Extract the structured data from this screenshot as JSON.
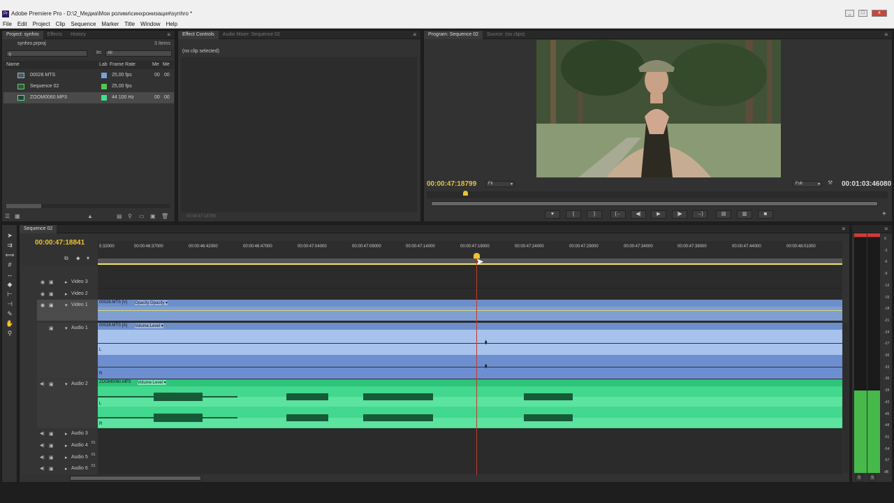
{
  "window": {
    "app_icon": "Pr",
    "title": "Adobe Premiere Pro - D:\\2_Медиа\\Мои ролики\\синхронизация\\synhro *"
  },
  "menu": [
    "File",
    "Edit",
    "Project",
    "Clip",
    "Sequence",
    "Marker",
    "Title",
    "Window",
    "Help"
  ],
  "project_panel": {
    "tabs": [
      "Project: synhro",
      "Effects",
      "History"
    ],
    "project_file": "synhro.prproj",
    "item_count": "3 Items",
    "in_label": "In:",
    "in_value": "All",
    "columns": [
      "Name",
      "Lab",
      "Frame Rate",
      "Me",
      "Me"
    ],
    "items": [
      {
        "name": "00028.MTS",
        "color": "#7aa0d8",
        "rate": "25,00 fps",
        "m1": "00",
        "m2": "00"
      },
      {
        "name": "Sequence 02",
        "color": "#4fc84f",
        "rate": "25,00 fps",
        "m1": "",
        "m2": ""
      },
      {
        "name": "ZOOM0060.MP3",
        "color": "#3fe08c",
        "rate": "44 100 Hz",
        "m1": "00",
        "m2": "00"
      }
    ]
  },
  "effect_panel": {
    "tabs": [
      "Effect Controls",
      "Audio Mixer: Sequence 02"
    ],
    "message": "(no clip selected)",
    "timecode": "00:00:47:18799"
  },
  "program_monitor": {
    "tabs": [
      "Program: Sequence 02",
      "Source: (no clips)"
    ],
    "timecode": "00:00:47:18799",
    "zoom": "Fit",
    "quality": "Full",
    "duration": "00:01:03:46080"
  },
  "timeline": {
    "tab": "Sequence 02",
    "timecode": "00:00:47:18841",
    "ruler": [
      "5:32000",
      "00:00:46:37000",
      "00:00:46:42000",
      "00:00:46:47000",
      "00:00:47:04000",
      "00:00:47:09000",
      "00:00:47:14000",
      "00:00:47:19000",
      "00:00:47:24000",
      "00:00:47:29000",
      "00:00:47:34000",
      "00:00:47:39000",
      "00:00:47:44000",
      "00:00:48:01000"
    ],
    "tracks": {
      "video3": "Video 3",
      "video2": "Video 2",
      "video1": "Video 1",
      "audio1": "Audio 1",
      "audio2": "Audio 2",
      "audio3": "Audio 3",
      "audio4": "Audio 4",
      "audio5": "Audio 5",
      "audio6": "Audio 6",
      "surround": "51"
    },
    "clips": {
      "v1_name": "00028.MTS [V]",
      "v1_fx": "Opacity:Opacity ▾",
      "a1_name": "00028.MTS [A]",
      "a1_fx": "Volume:Level ▾",
      "a2_name": "ZOOM0060.MP3",
      "a2_fx": "Volume:Level ▾",
      "ch_l": "L",
      "ch_r": "R"
    }
  },
  "meter": {
    "labels": [
      "0",
      "-3",
      "-6",
      "-9",
      "-12",
      "-15",
      "-18",
      "-21",
      "-24",
      "-27",
      "-30",
      "-33",
      "-36",
      "-39",
      "-42",
      "-45",
      "-48",
      "-51",
      "-54",
      "-57",
      "dB"
    ],
    "solo": "S",
    "level_left_db": -39,
    "level_right_db": -39
  },
  "icons": {
    "close": "x",
    "minimize": "_",
    "maximize": "□",
    "eye": "◉",
    "speaker": "◀)",
    "play": "▶",
    "step_back": "◀|",
    "step_fwd": "|▶",
    "marker": "♥",
    "in_point": "{",
    "out_point": "}",
    "goto_in": "{←",
    "goto_out": "→}",
    "lift": "▤",
    "extract": "▥",
    "export_frame": "◙",
    "wrench": "🔧",
    "plus": "+"
  }
}
